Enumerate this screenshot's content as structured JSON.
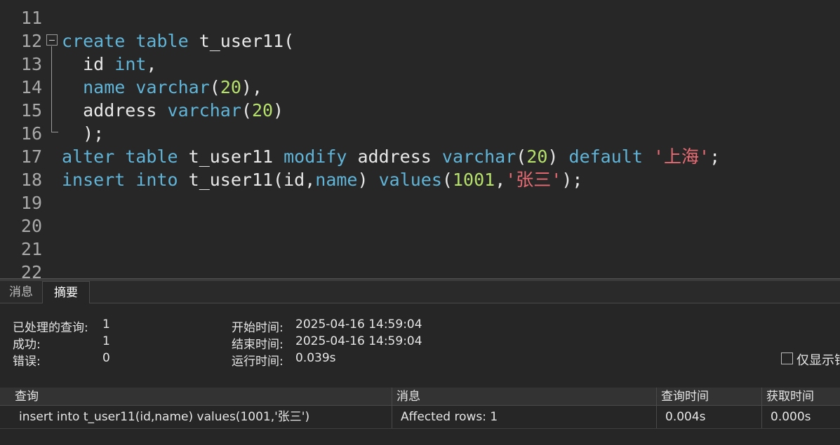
{
  "editor": {
    "lines": [
      {
        "num": "11",
        "tokens": []
      },
      {
        "num": "12",
        "tokens": [
          {
            "t": "create",
            "c": "kw"
          },
          {
            "t": " "
          },
          {
            "t": "table",
            "c": "kw"
          },
          {
            "t": " t_user11("
          }
        ]
      },
      {
        "num": "13",
        "tokens": [
          {
            "t": "  id "
          },
          {
            "t": "int",
            "c": "kw"
          },
          {
            "t": ","
          }
        ]
      },
      {
        "num": "14",
        "tokens": [
          {
            "t": "  "
          },
          {
            "t": "name",
            "c": "kw"
          },
          {
            "t": " "
          },
          {
            "t": "varchar",
            "c": "kw"
          },
          {
            "t": "("
          },
          {
            "t": "20",
            "c": "num"
          },
          {
            "t": "),"
          }
        ]
      },
      {
        "num": "15",
        "tokens": [
          {
            "t": "  address "
          },
          {
            "t": "varchar",
            "c": "kw"
          },
          {
            "t": "("
          },
          {
            "t": "20",
            "c": "num"
          },
          {
            "t": ")"
          }
        ]
      },
      {
        "num": "16",
        "tokens": [
          {
            "t": "  );"
          }
        ]
      },
      {
        "num": "17",
        "tokens": [
          {
            "t": "alter",
            "c": "kw"
          },
          {
            "t": " "
          },
          {
            "t": "table",
            "c": "kw"
          },
          {
            "t": " t_user11 "
          },
          {
            "t": "modify",
            "c": "kw"
          },
          {
            "t": " address "
          },
          {
            "t": "varchar",
            "c": "kw"
          },
          {
            "t": "("
          },
          {
            "t": "20",
            "c": "num"
          },
          {
            "t": ") "
          },
          {
            "t": "default",
            "c": "kw"
          },
          {
            "t": " "
          },
          {
            "t": "'上海'",
            "c": "str"
          },
          {
            "t": ";"
          }
        ]
      },
      {
        "num": "18",
        "tokens": [
          {
            "t": "insert",
            "c": "kw"
          },
          {
            "t": " "
          },
          {
            "t": "into",
            "c": "kw"
          },
          {
            "t": " t_user11(id,"
          },
          {
            "t": "name",
            "c": "kw"
          },
          {
            "t": ") "
          },
          {
            "t": "values",
            "c": "kw"
          },
          {
            "t": "("
          },
          {
            "t": "1001",
            "c": "num"
          },
          {
            "t": ","
          },
          {
            "t": "'张三'",
            "c": "str"
          },
          {
            "t": ");"
          }
        ]
      },
      {
        "num": "19",
        "tokens": []
      },
      {
        "num": "20",
        "tokens": []
      },
      {
        "num": "21",
        "tokens": []
      },
      {
        "num": "22",
        "tokens": []
      }
    ]
  },
  "tabs": {
    "messages": "消息",
    "summary": "摘要"
  },
  "summary": {
    "processed_label": "已处理的查询:",
    "processed_value": "1",
    "success_label": "成功:",
    "success_value": "1",
    "error_label": "错误:",
    "error_value": "0",
    "start_label": "开始时间:",
    "start_value": "2025-04-16 14:59:04",
    "end_label": "结束时间:",
    "end_value": "2025-04-16 14:59:04",
    "run_label": "运行时间:",
    "run_value": "0.039s",
    "only_show_errors_label": "仅显示错"
  },
  "grid": {
    "headers": [
      "查询",
      "消息",
      "查询时间",
      "获取时间"
    ],
    "rows": [
      [
        "insert into t_user11(id,name) values(1001,'张三')",
        "Affected rows: 1",
        "0.004s",
        "0.000s"
      ]
    ]
  },
  "colors": {
    "keyword": "#5fb4d8",
    "number": "#b5e06a",
    "string": "#e86a72"
  }
}
